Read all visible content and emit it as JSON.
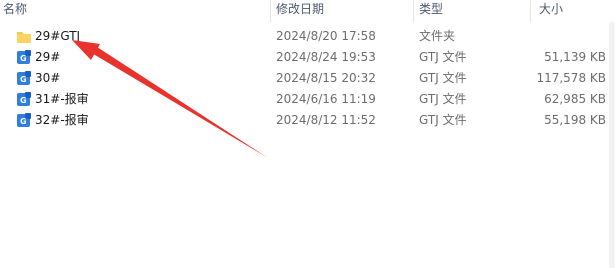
{
  "columns": {
    "name": "名称",
    "date": "修改日期",
    "type": "类型",
    "size": "大小"
  },
  "files": [
    {
      "name": "29#GTJ",
      "date": "2024/8/20 17:58",
      "type": "文件夹",
      "size": "",
      "icon": "folder-icon"
    },
    {
      "name": "29#",
      "date": "2024/8/24 19:53",
      "type": "GTJ 文件",
      "size": "51,139 KB",
      "icon": "gtj-file-icon"
    },
    {
      "name": "30#",
      "date": "2024/8/15 20:32",
      "type": "GTJ 文件",
      "size": "117,578 KB",
      "icon": "gtj-file-icon"
    },
    {
      "name": "31#-报审",
      "date": "2024/6/16 11:19",
      "type": "GTJ 文件",
      "size": "62,985 KB",
      "icon": "gtj-file-icon"
    },
    {
      "name": "32#-报审",
      "date": "2024/8/12 11:52",
      "type": "GTJ 文件",
      "size": "55,198 KB",
      "icon": "gtj-file-icon"
    }
  ],
  "colors": {
    "arrow": "#e8322b",
    "folder": "#f6c84c",
    "gtj_icon": "#2f7fe0"
  }
}
